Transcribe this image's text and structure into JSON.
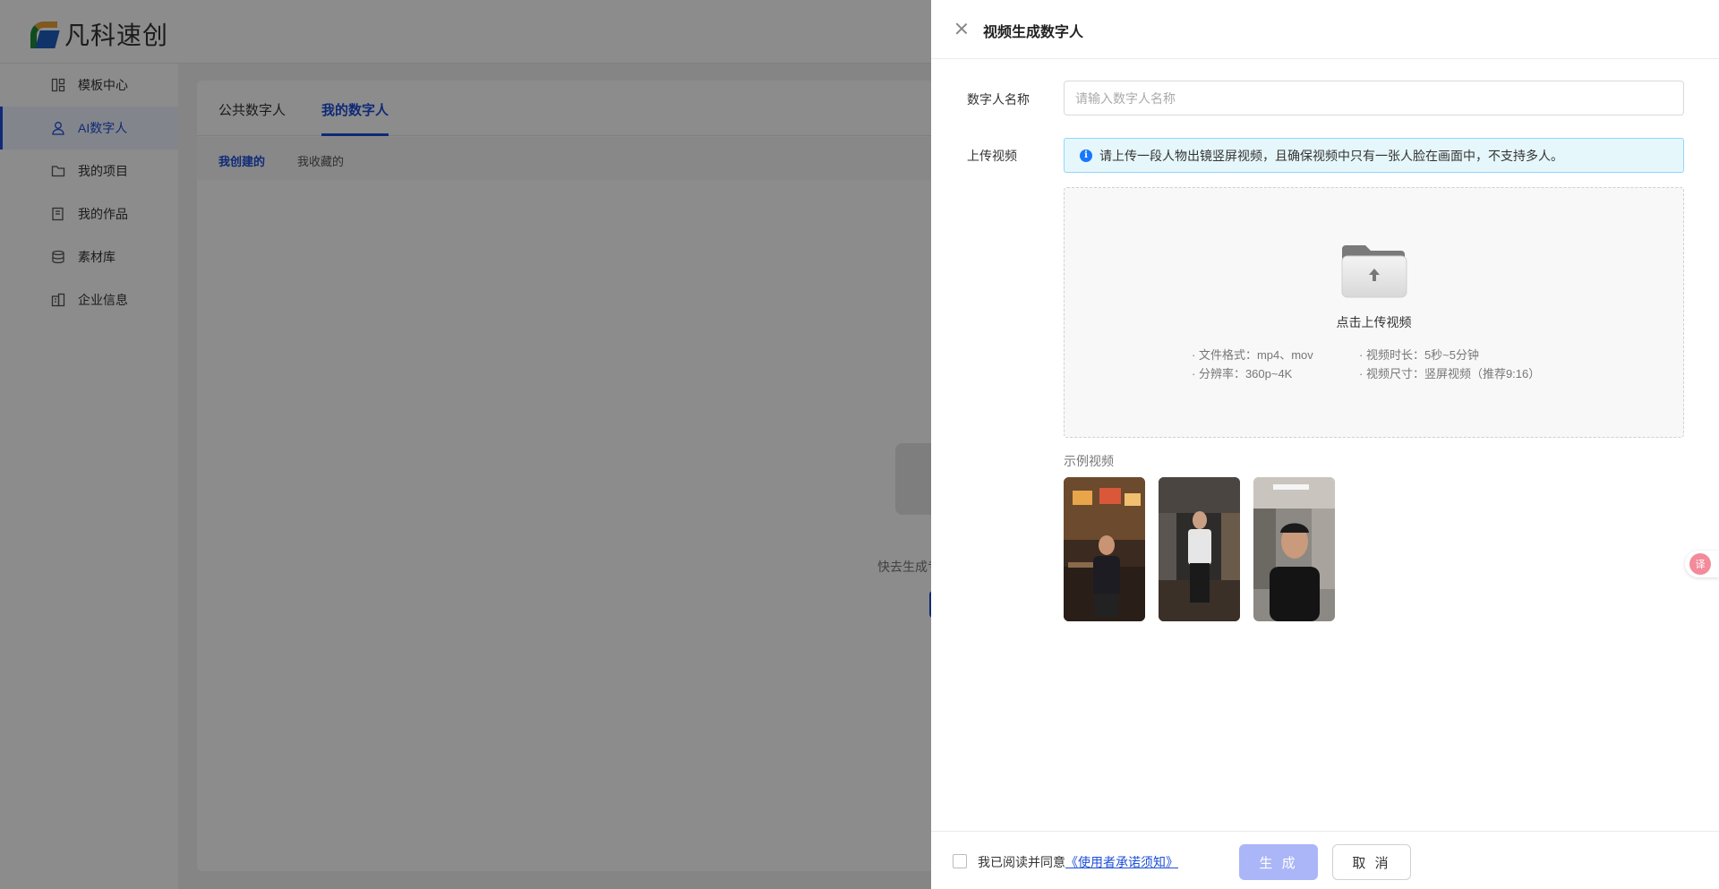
{
  "app": {
    "logo_text": "凡科速创"
  },
  "sidebar": {
    "items": [
      {
        "label": "模板中心",
        "icon": "template-icon",
        "active": false
      },
      {
        "label": "AI数字人",
        "icon": "user-icon",
        "active": true
      },
      {
        "label": "我的项目",
        "icon": "folder-icon",
        "active": false
      },
      {
        "label": "我的作品",
        "icon": "works-icon",
        "active": false
      },
      {
        "label": "素材库",
        "icon": "database-icon",
        "active": false
      },
      {
        "label": "企业信息",
        "icon": "building-icon",
        "active": false
      }
    ]
  },
  "main": {
    "tabs": [
      {
        "label": "公共数字人",
        "active": false
      },
      {
        "label": "我的数字人",
        "active": true
      }
    ],
    "subtabs": [
      {
        "label": "我创建的",
        "active": true
      },
      {
        "label": "我收藏的",
        "active": false
      }
    ],
    "empty_text": "快去生成专属"
  },
  "drawer": {
    "title": "视频生成数字人",
    "name_label": "数字人名称",
    "name_placeholder": "请输入数字人名称",
    "name_value": "",
    "upload_label": "上传视频",
    "notice": "请上传一段人物出镜竖屏视频，且确保视频中只有一张人脸在画面中，不支持多人。",
    "upload_title": "点击上传视频",
    "specs": {
      "format": "· 文件格式：mp4、mov",
      "duration": "· 视频时长：5秒~5分钟",
      "resolution": "· 分辨率：360p~4K",
      "size": "· 视频尺寸：竖屏视频（推荐9:16）"
    },
    "examples_label": "示例视频",
    "footer": {
      "agree_prefix": "我已阅读并同意",
      "agree_link": "《使用者承诺须知》",
      "generate_label": "生 成",
      "cancel_label": "取 消"
    }
  },
  "colors": {
    "primary": "#1d4ed8",
    "generate_disabled": "#aab6f7",
    "notice_bg": "#e6f7fb",
    "notice_border": "#91d5ff"
  }
}
